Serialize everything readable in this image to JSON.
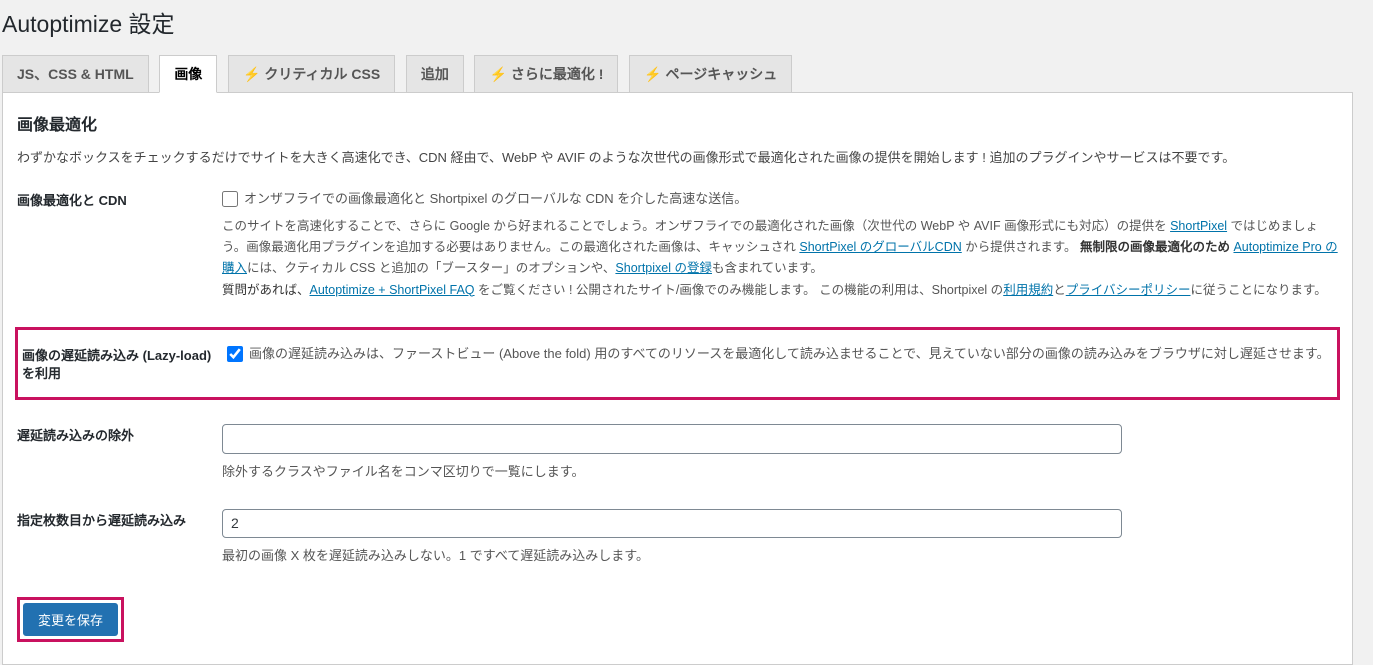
{
  "page": {
    "title": "Autoptimize 設定"
  },
  "tabs": [
    {
      "label": "JS、CSS & HTML"
    },
    {
      "label": "画像",
      "active": true
    },
    {
      "label": "クリティカル CSS",
      "lightning": true
    },
    {
      "label": "追加"
    },
    {
      "label": "さらに最適化 !",
      "lightning": true
    },
    {
      "label": "ページキャッシュ",
      "lightning": true
    }
  ],
  "section": {
    "title": "画像最適化",
    "intro": "わずかなボックスをチェックするだけでサイトを大きく高速化でき、CDN 経由で、WebP や AVIF のような次世代の画像形式で最適化された画像の提供を開始します ! 追加のプラグインやサービスは不要です。"
  },
  "cdn": {
    "label": "画像最適化と CDN",
    "checkbox_label": "オンザフライでの画像最適化と Shortpixel のグローバルな CDN を介した高速な送信。",
    "desc_part1": "このサイトを高速化することで、さらに Google から好まれることでしょう。オンザフライでの最適化された画像（次世代の WebP や AVIF 画像形式にも対応）の提供を ",
    "link_shortpixel": "ShortPixel",
    "desc_part2": " ではじめましょう。画像最適化用プラグインを追加する必要はありません。この最適化された画像は、キャッシュされ ",
    "link_cdn": "ShortPixel のグローバルCDN",
    "desc_part3": " から提供されます。 ",
    "bold1": "無制限の画像最適化のため",
    "link_pro": "Autoptimize Pro の購入",
    "desc_part4": "には、クティカル CSS と追加の「ブースター」のオプションや、",
    "link_register": "Shortpixel の登録",
    "desc_part5": "も含まれています。",
    "desc_q1": "質問があれば、",
    "link_faq": "Autoptimize + ShortPixel FAQ",
    "desc_q2": " をご覧ください ! 公開されたサイト/画像でのみ機能します。 この機能の利用は、Shortpixel の",
    "link_terms": "利用規約",
    "desc_q3": "と",
    "link_privacy": "プライバシーポリシー",
    "desc_q4": "に従うことになります。"
  },
  "lazy": {
    "label": "画像の遅延読み込み (Lazy-load) を利用",
    "checkbox_label": "画像の遅延読み込みは、ファーストビュー (Above the fold) 用のすべてのリソースを最適化して読み込ませることで、見えていない部分の画像の読み込みをブラウザに対し遅延させます。"
  },
  "exclude": {
    "label": "遅延読み込みの除外",
    "placeholder": "",
    "value": "",
    "help": "除外するクラスやファイル名をコンマ区切りで一覧にします。"
  },
  "skip": {
    "label": "指定枚数目から遅延読み込み",
    "value": "2",
    "help": "最初の画像 X 枚を遅延読み込みしない。1 ですべて遅延読み込みします。"
  },
  "buttons": {
    "save": "変更を保存"
  }
}
